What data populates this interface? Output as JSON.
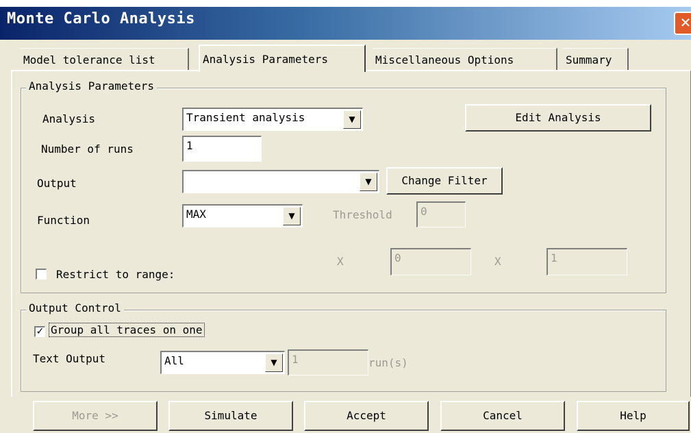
{
  "window": {
    "title": "Monte Carlo Analysis",
    "close_glyph": "✕"
  },
  "tabs": [
    {
      "label": "Model tolerance list"
    },
    {
      "label": "Analysis Parameters",
      "active": true
    },
    {
      "label": "Miscellaneous Options"
    },
    {
      "label": "Summary"
    }
  ],
  "analysis_params": {
    "group_label": "Analysis Parameters",
    "analysis_label": "Analysis",
    "analysis_value": "Transient analysis",
    "edit_analysis_label": "Edit Analysis",
    "runs_label": "Number of runs",
    "runs_value": "1",
    "output_label": "Output",
    "output_value": "",
    "change_filter_label": "Change Filter",
    "function_label": "Function",
    "function_value": "MAX",
    "threshold_label": "Threshold",
    "threshold_value": "0",
    "restrict_label": "Restrict to range:",
    "restrict_checked": false,
    "x1_label": "X",
    "x1_value": "0",
    "x2_label": "X",
    "x2_value": "1"
  },
  "output_control": {
    "group_label": "Output Control",
    "group_traces_label": "Group all traces on one",
    "group_traces_checked": true,
    "check_glyph": "✓",
    "text_output_label": "Text Output",
    "text_output_value": "All",
    "runs_field_value": "1",
    "runs_unit": "run(s)"
  },
  "buttons": {
    "more": "More >>",
    "simulate": "Simulate",
    "accept": "Accept",
    "cancel": "Cancel",
    "help": "Help"
  },
  "icons": {
    "dropdown_arrow": "▼"
  }
}
